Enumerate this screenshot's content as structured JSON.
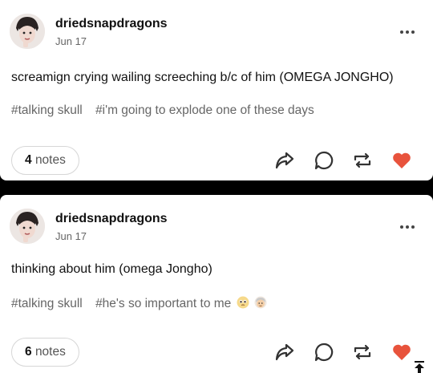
{
  "posts": [
    {
      "username": "driedsnapdragons",
      "date": "Jun 17",
      "body": "screamign crying wailing screeching b/c of him (OMEGA JONGHO)",
      "tags": [
        "#talking skull",
        "#i'm going to explode one of these days"
      ],
      "notes_count": "4",
      "notes_label": "notes"
    },
    {
      "username": "driedsnapdragons",
      "date": "Jun 17",
      "body": "thinking about him (omega Jongho)",
      "tags": [
        "#talking skull",
        "#he's so important to me"
      ],
      "notes_count": "6",
      "notes_label": "notes"
    }
  ],
  "icons": {
    "more": "more-options-icon",
    "share": "share-icon",
    "reply": "reply-icon",
    "reblog": "reblog-icon",
    "like": "heart-icon",
    "scroll_top": "scroll-to-top-icon"
  },
  "colors": {
    "like": "#e8533c",
    "icon": "#333333",
    "muted_text": "#666666"
  }
}
